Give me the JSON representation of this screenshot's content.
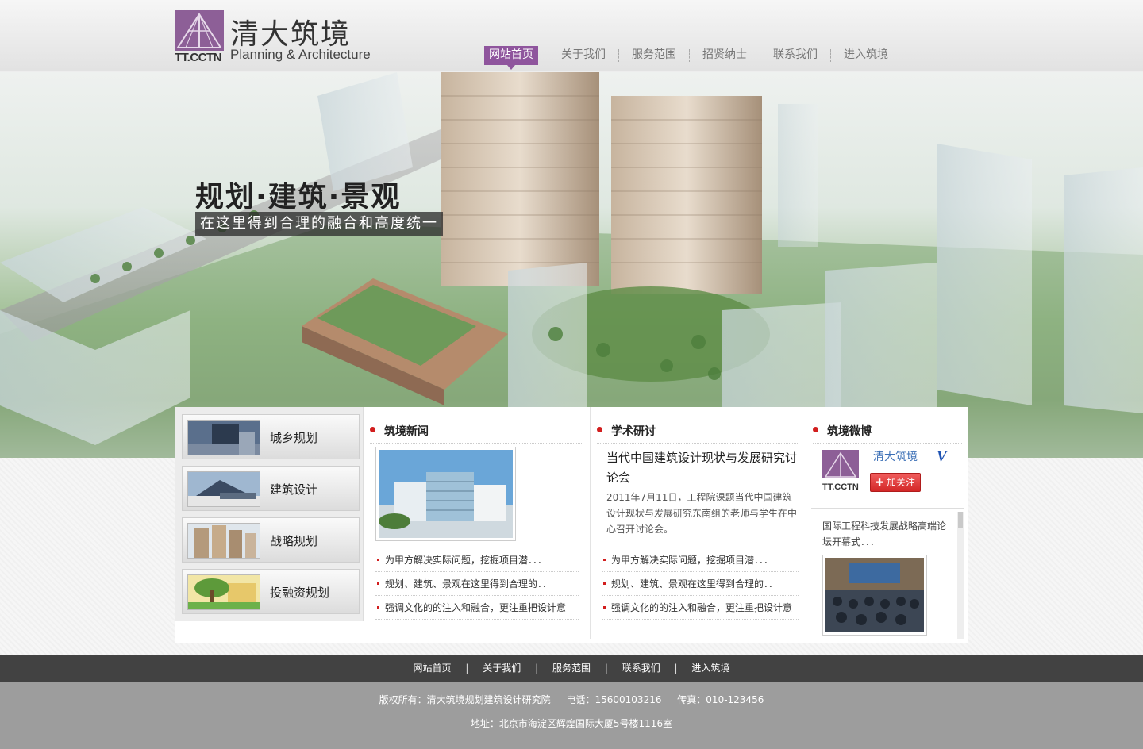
{
  "header": {
    "logo_cn": "清大筑境",
    "logo_en": "Planning & Architecture",
    "logo_abbr": "TT.CCTN"
  },
  "nav": {
    "items": [
      {
        "label": "网站首页",
        "active": true
      },
      {
        "label": "关于我们"
      },
      {
        "label": "服务范围"
      },
      {
        "label": "招贤纳士"
      },
      {
        "label": "联系我们"
      },
      {
        "label": "进入筑境"
      }
    ],
    "active_color": "#8f559d"
  },
  "banner": {
    "slogan": "规划·建筑·景观",
    "subslogan": "在这里得到合理的融合和高度统一"
  },
  "services": [
    {
      "label": "城乡规划",
      "thumb": "building-photo"
    },
    {
      "label": "建筑设计",
      "thumb": "stadium-photo"
    },
    {
      "label": "战略规划",
      "thumb": "highrise-photo"
    },
    {
      "label": "投融资规划",
      "thumb": "tree-photo"
    }
  ],
  "news": {
    "title": "筑境新闻",
    "items": [
      "为甲方解决实际问题，挖掘项目潜．．．",
      "规划、建筑、景观在这里得到合理的．．",
      "强调文化的的注入和融合，更注重把设计意"
    ]
  },
  "forum": {
    "title": "学术研讨",
    "headline": "当代中国建筑设计现状与发展研究讨论会",
    "summary": "2011年7月11日，工程院课题当代中国建筑设计现状与发展研究东南组的老师与学生在中心召开讨论会。",
    "items": [
      "为甲方解决实际问题，挖掘项目潜．．．",
      "规划、建筑、景观在这里得到合理的．．",
      "强调文化的的注入和融合，更注重把设计意"
    ]
  },
  "weibo": {
    "title": "筑境微博",
    "account": "清大筑境",
    "verified_mark": "V",
    "follow_label": "加关注",
    "post_text": "国际工程科技发展战略高端论坛开幕式．．．",
    "accent_color": "#d21e1e"
  },
  "footer": {
    "nav": [
      "网站首页",
      "关于我们",
      "服务范围",
      "联系我们",
      "进入筑境"
    ],
    "separator": "|",
    "copyright": "版权所有：清大筑境规划建筑设计研究院",
    "phone": "电话：15600103216",
    "fax": "传真：010-123456",
    "address": "地址：北京市海淀区辉煌国际大厦5号楼1116室"
  }
}
